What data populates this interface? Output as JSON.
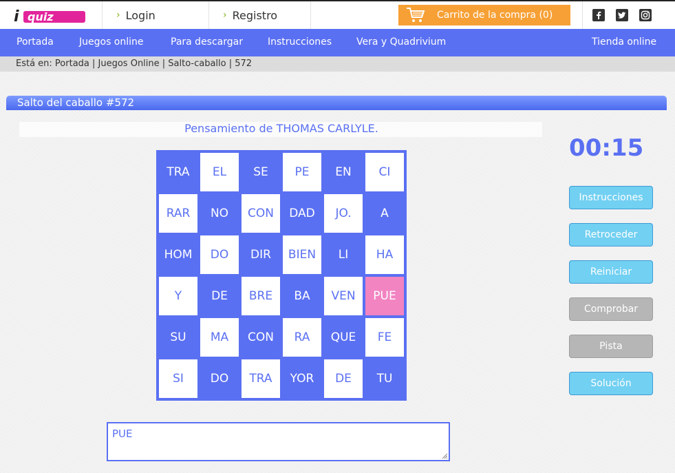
{
  "header": {
    "logo_text": "iquiz",
    "login_label": "Login",
    "registro_label": "Registro",
    "cart_label": "Carrito de la compra (0)",
    "social": [
      "facebook-icon",
      "twitter-icon",
      "instagram-icon"
    ],
    "accent_color": "#5a70f2",
    "cart_color": "#f7a035"
  },
  "nav": {
    "items": [
      "Portada",
      "Juegos online",
      "Para descargar",
      "Instrucciones",
      "Vera y Quadrivium"
    ],
    "store": "Tienda online"
  },
  "breadcrumb": "Está en: Portada | Juegos Online | Salto-caballo | 572",
  "game": {
    "title": "Salto del caballo #572",
    "quote_author": "Pensamiento de THOMAS CARLYLE.",
    "timer": "00:15",
    "board": [
      [
        "TRA",
        "EL",
        "SE",
        "PE",
        "EN",
        "CI"
      ],
      [
        "RAR",
        "NO",
        "CON",
        "DAD",
        "JO.",
        "A"
      ],
      [
        "HOM",
        "DO",
        "DIR",
        "BIEN",
        "LI",
        "HA"
      ],
      [
        "Y",
        "DE",
        "BRE",
        "BA",
        "VEN",
        "PUE"
      ],
      [
        "SU",
        "MA",
        "CON",
        "RA",
        "QUE",
        "FE"
      ],
      [
        "SI",
        "DO",
        "TRA",
        "YOR",
        "DE",
        "TU"
      ]
    ],
    "selected_cell": [
      3,
      5
    ],
    "selected_color": "#f284c2",
    "answer": "PUE"
  },
  "buttons": [
    {
      "label": "Instrucciones",
      "enabled": true
    },
    {
      "label": "Retroceder",
      "enabled": true
    },
    {
      "label": "Reiniciar",
      "enabled": true
    },
    {
      "label": "Comprobar",
      "enabled": false
    },
    {
      "label": "Pista",
      "enabled": false
    },
    {
      "label": "Solución",
      "enabled": true
    }
  ]
}
